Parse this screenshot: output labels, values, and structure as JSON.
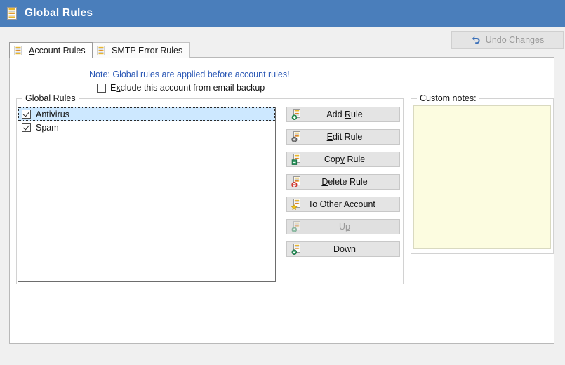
{
  "window": {
    "title": "Global Rules",
    "icon": "rules-document-icon"
  },
  "toolbar": {
    "undo_label": "Undo Changes",
    "undo_accel": "U",
    "undo_icon": "undo-arrow-icon",
    "undo_enabled": false
  },
  "tabs": [
    {
      "label": "Account Rules",
      "accel": "A",
      "icon": "rules-document-icon",
      "active": true
    },
    {
      "label": "SMTP Error Rules",
      "accel": "",
      "icon": "rules-document-icon",
      "active": false
    }
  ],
  "note": {
    "text": "Note: Global rules are applied before account rules!",
    "color": "#2b58b5"
  },
  "exclude_checkbox": {
    "label_before": "E",
    "label_accel": "x",
    "label_after": "clude this account from email backup",
    "checked": false
  },
  "global_rules_group": {
    "label": "Global Rules",
    "items": [
      {
        "label": "Antivirus",
        "checked": true,
        "selected": true
      },
      {
        "label": "Spam",
        "checked": true,
        "selected": false
      }
    ]
  },
  "buttons": [
    {
      "label_a": "Add ",
      "accel": "R",
      "label_b": "ule",
      "icon": "add-rule-icon",
      "enabled": true,
      "align": "center"
    },
    {
      "label_a": "",
      "accel": "E",
      "label_b": "dit Rule",
      "icon": "edit-rule-icon",
      "enabled": true,
      "align": "center"
    },
    {
      "label_a": "Cop",
      "accel": "y",
      "label_b": " Rule",
      "icon": "copy-rule-icon",
      "enabled": true,
      "align": "center"
    },
    {
      "label_a": "",
      "accel": "D",
      "label_b": "elete Rule",
      "icon": "delete-rule-icon",
      "enabled": true,
      "align": "center"
    },
    {
      "label_a": "",
      "accel": "T",
      "label_b": "o Other Account",
      "icon": "to-other-account-icon",
      "enabled": true,
      "align": "left"
    },
    {
      "label_a": "U",
      "accel": "p",
      "label_b": "",
      "icon": "move-up-icon",
      "enabled": false,
      "align": "center"
    },
    {
      "label_a": "D",
      "accel": "o",
      "label_b": "wn",
      "icon": "move-down-icon",
      "enabled": true,
      "align": "center"
    }
  ],
  "custom_notes": {
    "label": "Custom notes:",
    "value": "",
    "placeholder": "",
    "background": "#fcfce0"
  },
  "colors": {
    "titlebar": "#4a7ebb",
    "page_background": "#f0f0f0",
    "panel": "#ffffff",
    "selection": "#cde8ff",
    "note_text": "#2b58b5"
  }
}
